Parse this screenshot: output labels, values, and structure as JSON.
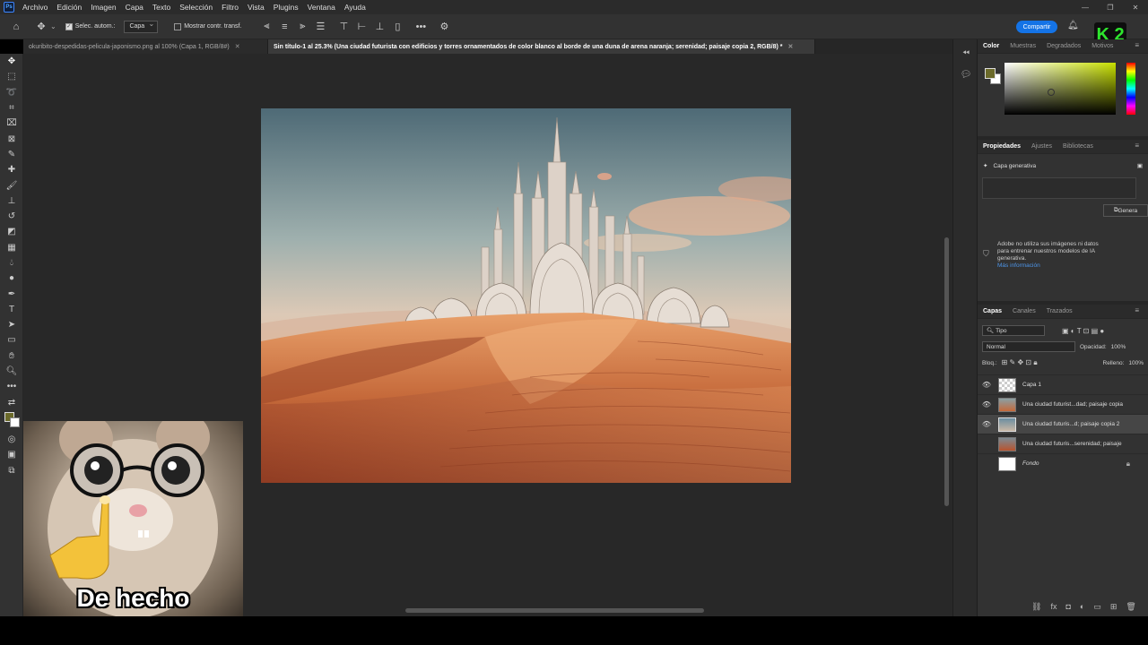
{
  "menubar": {
    "app_icon": "Ps",
    "items": [
      "Archivo",
      "Edición",
      "Imagen",
      "Capa",
      "Texto",
      "Selección",
      "Filtro",
      "Vista",
      "Plugins",
      "Ventana",
      "Ayuda"
    ]
  },
  "options_bar": {
    "auto_select_label": "Selec. autom.:",
    "auto_select_target": "Capa",
    "show_transform_label": "Mostrar contr. transf.",
    "share_label": "Compartir"
  },
  "tabs": [
    {
      "label": "okuribito-despedidas-pelicula-japonismo.png al 100% (Capa 1, RGB/8#)",
      "active": false
    },
    {
      "label": "Sin título-1 al 25.3% (Una ciudad futurista con edificios y torres ornamentados de color blanco al borde de una duna de arena naranja; serenidad; paisaje copia 2, RGB/8) *",
      "active": true
    }
  ],
  "color_panel": {
    "tabs": [
      "Color",
      "Muestras",
      "Degradados",
      "Motivos"
    ],
    "foreground": "#6b6a2a",
    "background": "#ffffff"
  },
  "properties": {
    "tabs": [
      "Propiedades",
      "Ajustes",
      "Bibliotecas"
    ],
    "layer_type": "Capa generativa",
    "generate_label": "Genera",
    "info_text": "Adobe no utiliza sus imágenes ni datos para entrenar nuestros modelos de IA generativa.",
    "more_info": "Más información"
  },
  "layers": {
    "tabs": [
      "Capas",
      "Canales",
      "Trazados"
    ],
    "filter": "Tipo",
    "blend_mode": "Normal",
    "opacity_label": "Opacidad:",
    "opacity_value": "100%",
    "lock_label": "Bloq.:",
    "fill_label": "Relleno:",
    "fill_value": "100%",
    "items": [
      {
        "name": "Capa 1",
        "visible": true,
        "selected": false
      },
      {
        "name": "Una ciudad futurist...dad; paisaje copia",
        "visible": true,
        "selected": false
      },
      {
        "name": "Una ciudad futuris...d; paisaje copia 2",
        "visible": true,
        "selected": true
      },
      {
        "name": "Una ciudad futuris...serenidad; paisaje",
        "visible": false,
        "selected": false
      },
      {
        "name": "Fondo",
        "visible": false,
        "selected": false,
        "locked": true
      }
    ]
  },
  "overlay": {
    "caption": "De hecho",
    "badge": "K 2"
  },
  "colors": {
    "accent": "#1473e6",
    "panel_bg": "#323232",
    "canvas_bg": "#282828"
  }
}
